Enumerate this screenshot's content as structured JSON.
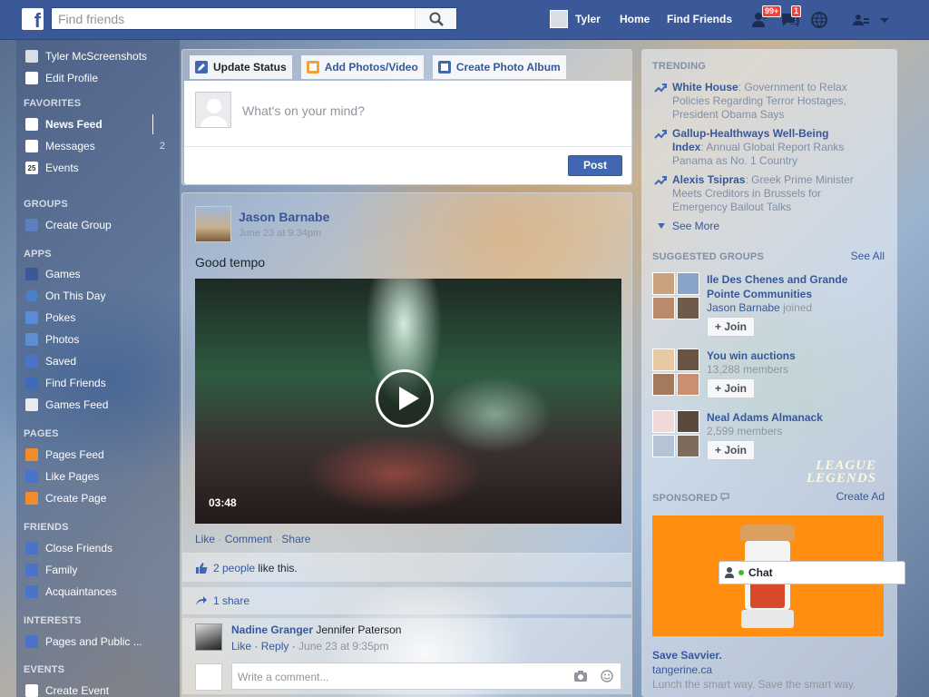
{
  "topbar": {
    "logo": "f",
    "search_placeholder": "Find friends",
    "profile_name": "Tyler",
    "nav": [
      "Home",
      "Find Friends"
    ],
    "badges": {
      "friend_requests": "99+",
      "messages": "1"
    }
  },
  "left": {
    "profile_name": "Tyler McScreenshots",
    "edit_profile": "Edit Profile",
    "headers": [
      "FAVORITES",
      "GROUPS",
      "APPS",
      "PAGES",
      "FRIENDS",
      "INTERESTS",
      "EVENTS"
    ],
    "favorites": [
      {
        "label": "News Feed",
        "icon": "news-feed-icon"
      },
      {
        "label": "Messages",
        "icon": "messages-icon",
        "count": "2"
      },
      {
        "label": "Events",
        "icon": "events-icon",
        "glyph": "25"
      }
    ],
    "groups": [
      {
        "label": "Create Group",
        "icon": "create-group-icon"
      }
    ],
    "apps": [
      {
        "label": "Games",
        "icon": "games-icon"
      },
      {
        "label": "On This Day",
        "icon": "on-this-day-icon"
      },
      {
        "label": "Pokes",
        "icon": "pokes-icon"
      },
      {
        "label": "Photos",
        "icon": "photos-icon"
      },
      {
        "label": "Saved",
        "icon": "saved-icon"
      },
      {
        "label": "Find Friends",
        "icon": "find-friends-icon"
      },
      {
        "label": "Games Feed",
        "icon": "games-feed-icon"
      }
    ],
    "pages": [
      {
        "label": "Pages Feed",
        "icon": "pages-feed-icon"
      },
      {
        "label": "Like Pages",
        "icon": "like-pages-icon"
      },
      {
        "label": "Create Page",
        "icon": "create-page-icon"
      }
    ],
    "friends": [
      {
        "label": "Close Friends",
        "icon": "close-friends-icon"
      },
      {
        "label": "Family",
        "icon": "family-icon"
      },
      {
        "label": "Acquaintances",
        "icon": "acquaintances-icon"
      }
    ],
    "interests": [
      {
        "label": "Pages and Public ...",
        "icon": "pages-public-icon"
      }
    ],
    "events": [
      {
        "label": "Create Event",
        "icon": "create-event-icon"
      }
    ]
  },
  "composer": {
    "tabs": [
      "Update Status",
      "Add Photos/Video",
      "Create Photo Album"
    ],
    "prompt": "What's on your mind?",
    "post_label": "Post"
  },
  "post": {
    "author": "Jason Barnabe",
    "timestamp": "June 23 at 9:34pm",
    "text": "Good tempo",
    "video_duration": "03:48",
    "actions": [
      "Like",
      "Comment",
      "Share"
    ],
    "likes_link": "2 people",
    "likes_suffix": " like this.",
    "shares": "1 share",
    "comment": {
      "author": "Nadine Granger",
      "text": "Jennifer Paterson",
      "actions": [
        "Like",
        "Reply"
      ],
      "when": "June 23 at 9:35pm"
    },
    "write_placeholder": "Write a comment..."
  },
  "right": {
    "trending_header": "TRENDING",
    "trending": [
      {
        "topic": "White House",
        "desc": ": Government to Relax Policies Regarding Terror Hostages, President Obama Says"
      },
      {
        "topic": "Gallup-Healthways Well-Being Index",
        "desc": ": Annual Global Report Ranks Panama as No. 1 Country"
      },
      {
        "topic": "Alexis Tsipras",
        "desc": ": Greek Prime Minister Meets Creditors in Brussels for Emergency Bailout Talks"
      }
    ],
    "see_more": "See More",
    "groups_header": "SUGGESTED GROUPS",
    "see_all": "See All",
    "groups": [
      {
        "name": "Ile Des Chenes and Grande Pointe Communities",
        "sub_link": "Jason Barnabe",
        "sub_text": " joined",
        "join": "Join"
      },
      {
        "name": "You win auctions",
        "sub_text": "13,288 members",
        "join": "Join"
      },
      {
        "name": "Neal Adams Almanack",
        "sub_text": "2,599 members",
        "join": "Join"
      }
    ],
    "watermark": [
      "LEAGUE",
      "LEGENDS"
    ],
    "sponsored_header": "SPONSORED",
    "create_ad": "Create Ad",
    "ad": {
      "title": "Save Savvier.",
      "domain": "tangerine.ca",
      "desc": "Lunch the smart way. Save the smart way."
    }
  },
  "chat": {
    "label": "Chat"
  }
}
